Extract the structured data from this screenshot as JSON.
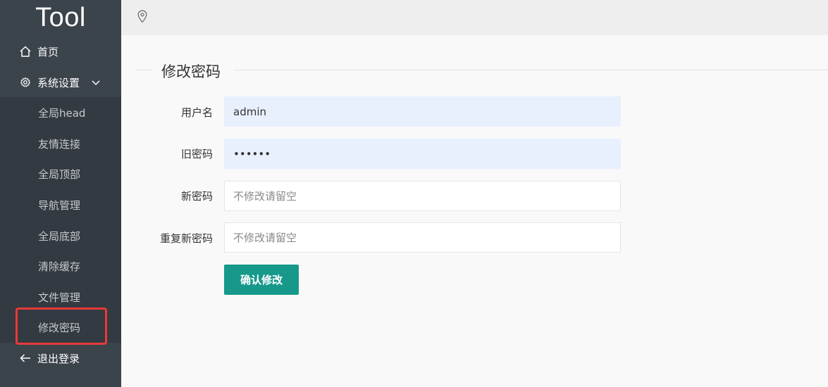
{
  "app": {
    "logo_text": "Tool"
  },
  "sidebar": {
    "home": {
      "label": "首页",
      "icon": "home-icon"
    },
    "settings": {
      "label": "系统设置",
      "icon": "gear-icon",
      "expanded": true
    },
    "sub_items": [
      {
        "label": "全局head"
      },
      {
        "label": "友情连接"
      },
      {
        "label": "全局顶部"
      },
      {
        "label": "导航管理"
      },
      {
        "label": "全局底部"
      },
      {
        "label": "清除缓存"
      },
      {
        "label": "文件管理"
      },
      {
        "label": "修改密码",
        "highlighted": true
      }
    ],
    "logout": {
      "label": "退出登录",
      "icon": "arrow-left-icon"
    }
  },
  "topbar": {
    "icon": "location-pin-icon"
  },
  "form": {
    "title": "修改密码",
    "username": {
      "label": "用户名",
      "value": "admin"
    },
    "old_password": {
      "label": "旧密码",
      "value": "••••••"
    },
    "new_password": {
      "label": "新密码",
      "value": "",
      "placeholder": "不修改请留空"
    },
    "repeat_password": {
      "label": "重复新密码",
      "value": "",
      "placeholder": "不修改请留空"
    },
    "submit_label": "确认修改"
  },
  "colors": {
    "sidebar_bg": "#3b434b",
    "submenu_bg": "#333a41",
    "accent": "#16998b",
    "highlight_border": "#e93a3a",
    "autofill_bg": "#e8f0fe"
  }
}
